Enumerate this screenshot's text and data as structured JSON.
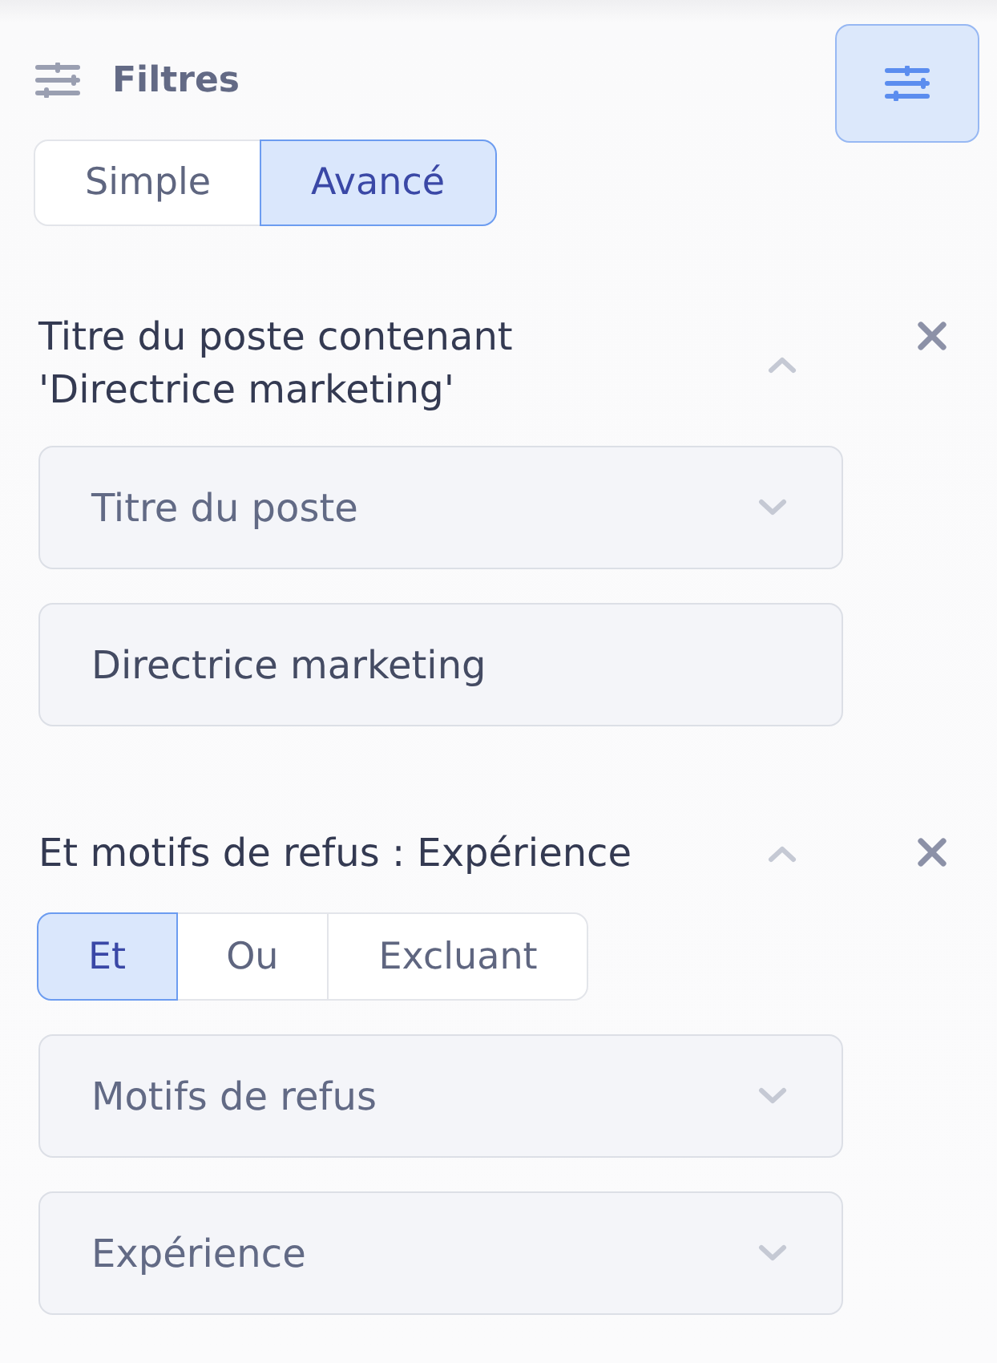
{
  "header": {
    "title": "Filtres",
    "filter_toggle": {
      "on": true
    }
  },
  "mode_tabs": [
    {
      "label": "Simple",
      "selected": false
    },
    {
      "label": "Avancé",
      "selected": true
    }
  ],
  "filters": [
    {
      "title": "Titre du poste contenant\n'Directrice marketing'",
      "expanded": true,
      "fields": [
        {
          "kind": "select",
          "value": "Titre du poste"
        },
        {
          "kind": "text",
          "value": "Directrice marketing"
        }
      ]
    },
    {
      "title": "Et motifs de refus : Expérience",
      "expanded": true,
      "operators": [
        {
          "label": "Et",
          "selected": true
        },
        {
          "label": "Ou",
          "selected": false
        },
        {
          "label": "Excluant",
          "selected": false
        }
      ],
      "fields": [
        {
          "kind": "select",
          "value": "Motifs de refus"
        },
        {
          "kind": "select",
          "value": "Expérience"
        }
      ]
    }
  ]
}
